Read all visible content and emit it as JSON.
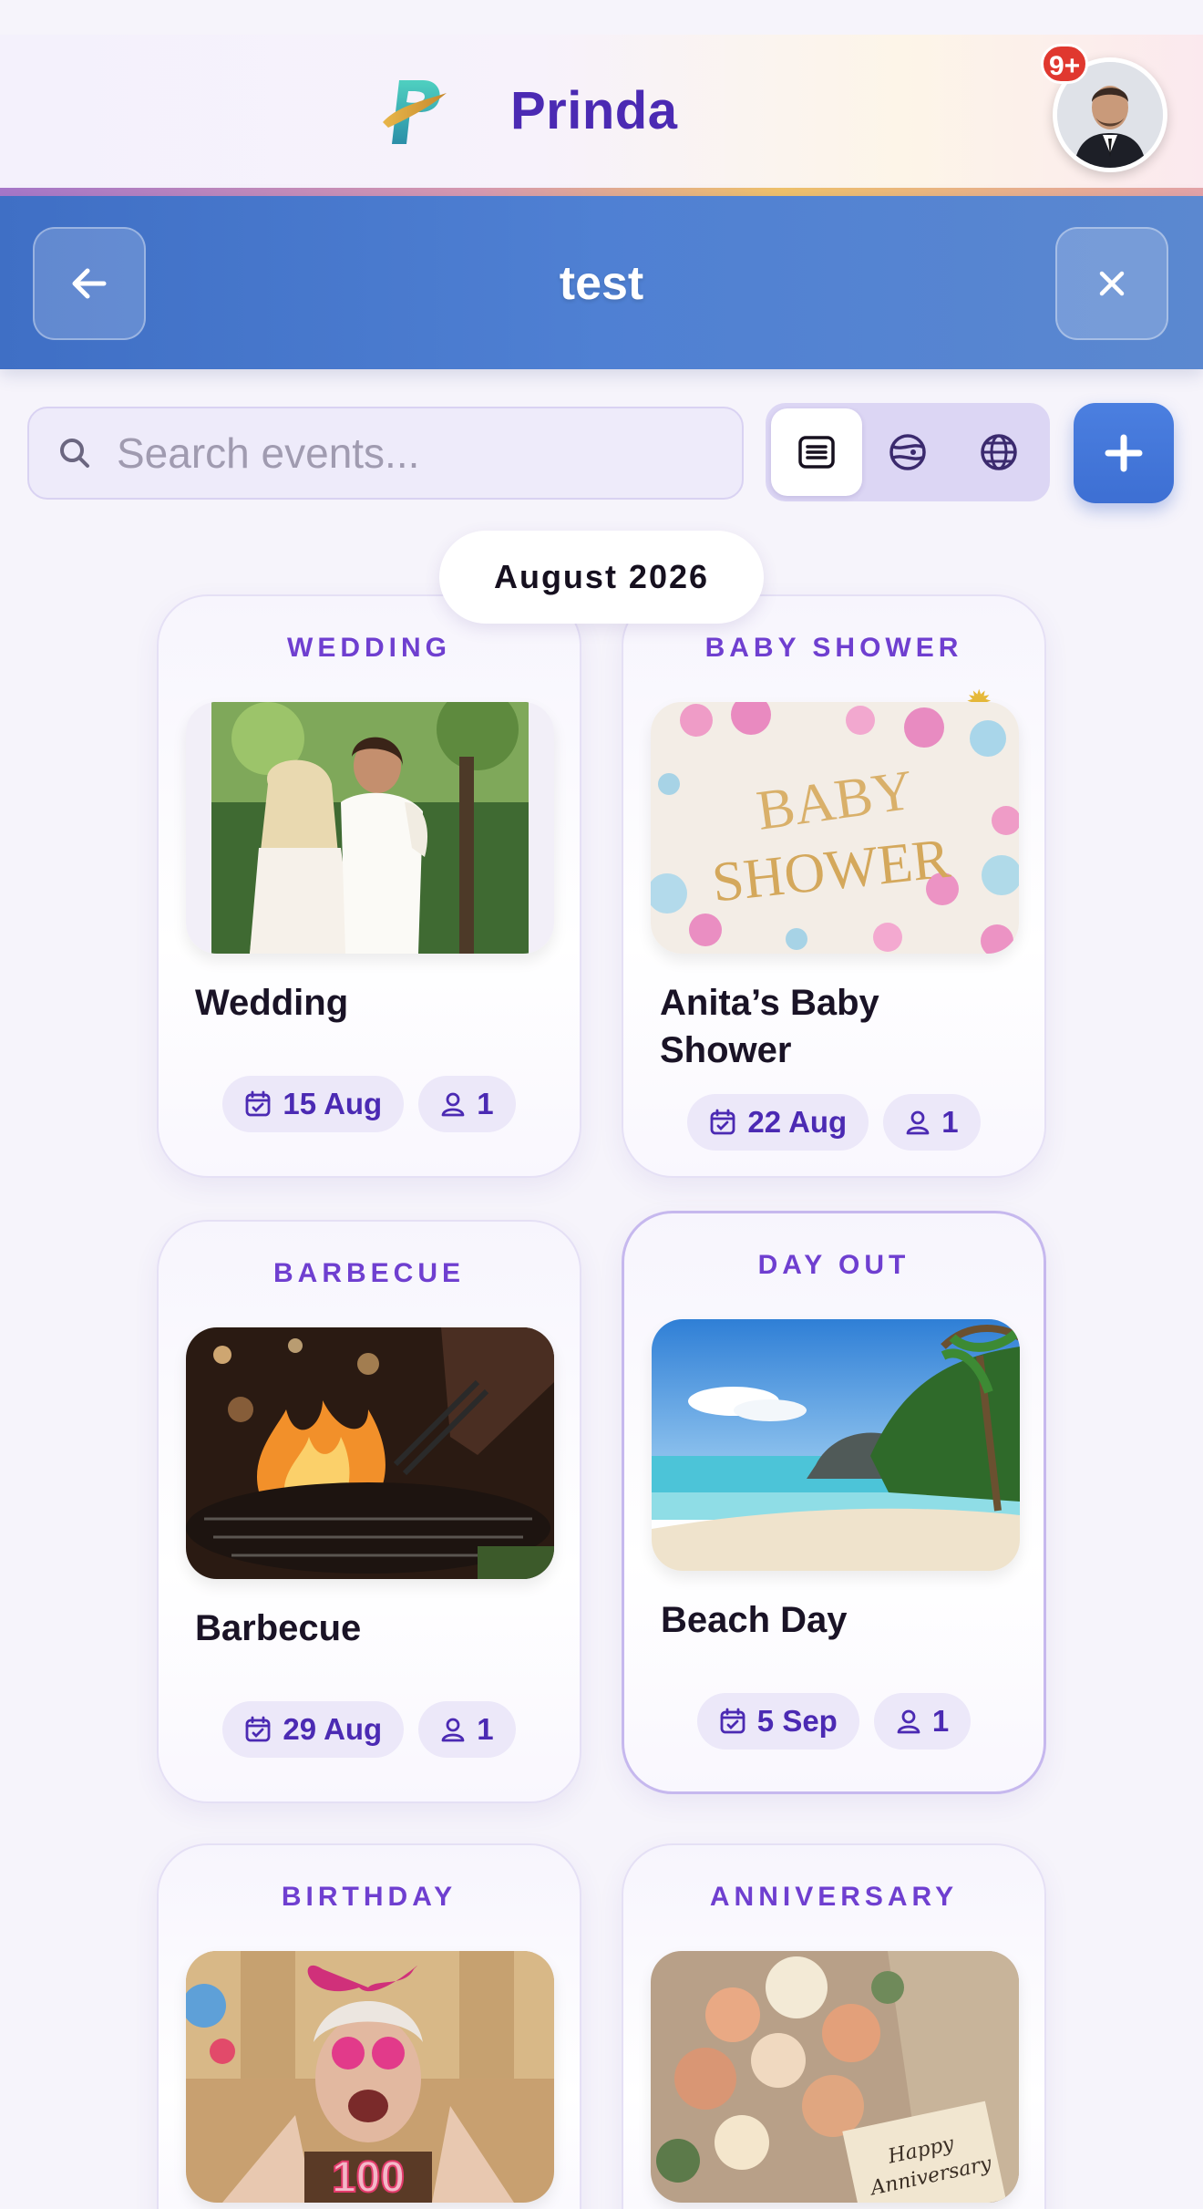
{
  "app": {
    "name": "Prinda",
    "notification_count": "9+"
  },
  "title_bar": {
    "title": "test"
  },
  "search": {
    "placeholder": "Search events..."
  },
  "view_modes": [
    "list-view",
    "calendar-view",
    "globe-view"
  ],
  "month_label": "August 2026",
  "colors": {
    "accent": "#4b2ab3",
    "category": "#6f3fd0",
    "title_bar": "#4f80d3",
    "badge": "#e0382f"
  },
  "events": [
    {
      "category": "WEDDING",
      "name": "Wedding",
      "date": "15 Aug",
      "guests": "1"
    },
    {
      "category": "BABY SHOWER",
      "name": "Anita’s Baby Shower",
      "date": "22 Aug",
      "guests": "1"
    },
    {
      "category": "BARBECUE",
      "name": "Barbecue",
      "date": "29 Aug",
      "guests": "1"
    },
    {
      "category": "DAY OUT",
      "name": "Beach Day",
      "date": "5 Sep",
      "guests": "1"
    },
    {
      "category": "BIRTHDAY",
      "name": "",
      "date": "",
      "guests": ""
    },
    {
      "category": "ANNIVERSARY",
      "name": "",
      "date": "",
      "guests": ""
    }
  ],
  "image_text": {
    "baby_line1": "BABY",
    "baby_line2": "SHOWER",
    "cake_number": "100",
    "card_line1": "Happy",
    "card_line2": "Anniversary"
  }
}
